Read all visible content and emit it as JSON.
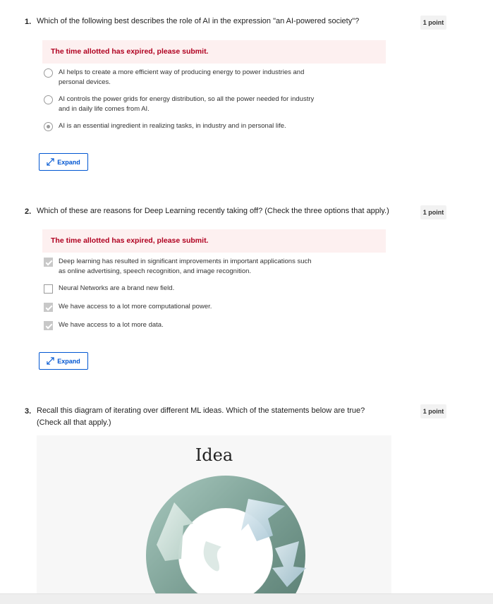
{
  "questions": [
    {
      "number": "1.",
      "text": "Which of the following best describes the role of AI in the expression \"an AI-powered society\"?",
      "points": "1 point",
      "alert": "The time allotted has expired, please submit.",
      "options": [
        {
          "text": "AI helps to create a more efficient way of producing energy to power industries and personal devices.",
          "checked": false
        },
        {
          "text": "AI controls the power grids for energy distribution, so all the power needed for industry and in daily life comes from AI.",
          "checked": false
        },
        {
          "text": "AI is an essential ingredient in realizing tasks, in industry and in personal life.",
          "checked": true
        }
      ],
      "expand_label": "Expand"
    },
    {
      "number": "2.",
      "text": "Which of these are reasons for Deep Learning recently taking off? (Check the three options that apply.)",
      "points": "1 point",
      "alert": "The time allotted has expired, please submit.",
      "options": [
        {
          "text": "Deep learning has resulted in significant improvements in important applications such as online advertising, speech recognition, and image recognition.",
          "checked": true
        },
        {
          "text": "Neural Networks are a brand new field.",
          "checked": false
        },
        {
          "text": "We have access to a lot more computational power.",
          "checked": true
        },
        {
          "text": "We have access to a lot more data.",
          "checked": true
        }
      ],
      "expand_label": "Expand"
    },
    {
      "number": "3.",
      "text": "Recall this diagram of iterating over different ML ideas. Which of the statements below are true? (Check all that apply.)",
      "points": "1 point",
      "diagram_title": "Idea"
    }
  ],
  "colors": {
    "accent": "#0056d2",
    "alert_text": "#b00020",
    "alert_bg": "#fdf0f0"
  }
}
